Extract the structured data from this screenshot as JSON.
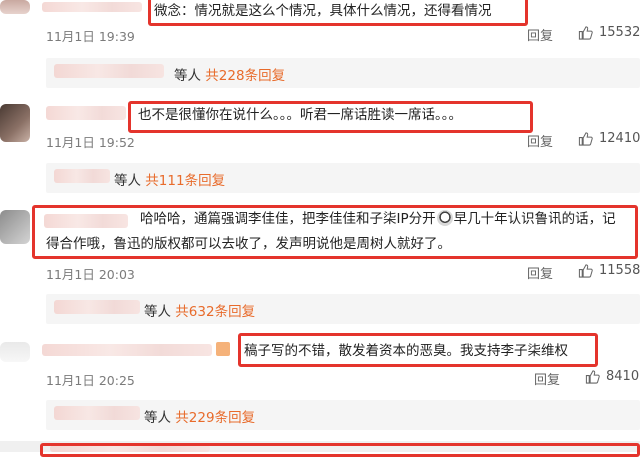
{
  "comments": [
    {
      "text": "微念：情况就是这么个情况，具体什么情况，还得看情况",
      "time": "11月1日 19:39",
      "reply": "回复",
      "likes": "15532"
    },
    {
      "text": "也不是很懂你在说什么。。。听君一席话胜读一席话。。。",
      "time": "11月1日 19:52",
      "reply": "回复",
      "likes": "12410"
    },
    {
      "line1": "哈哈哈，通篇强调李佳佳，把李佳佳和子柒IP分开",
      "line1b": "早几十年认识鲁讯的话，记",
      "line2": "得合作哦，鲁迅的版权都可以去收了，发声明说他是周树人就好了。",
      "time": "11月1日 20:03",
      "reply": "回复",
      "likes": "11558"
    },
    {
      "text": "稿子写的不错，散发着资本的恶臭。我支持李子柒维权",
      "time": "11月1日 20:25",
      "reply": "回复",
      "likes": "8410"
    }
  ],
  "subreplies": [
    {
      "prefix": "等人 ",
      "count": "共228条回复"
    },
    {
      "prefix": "等人 ",
      "count": "共111条回复"
    },
    {
      "prefix": "等人 ",
      "count": "共632条回复"
    },
    {
      "prefix": "等人 ",
      "count": "共229条回复"
    }
  ],
  "colors": {
    "highlight": "#e4342c",
    "reply_count": "#e86b2b"
  },
  "icons": [
    "thumbs-up-icon",
    "emoji-icon"
  ]
}
